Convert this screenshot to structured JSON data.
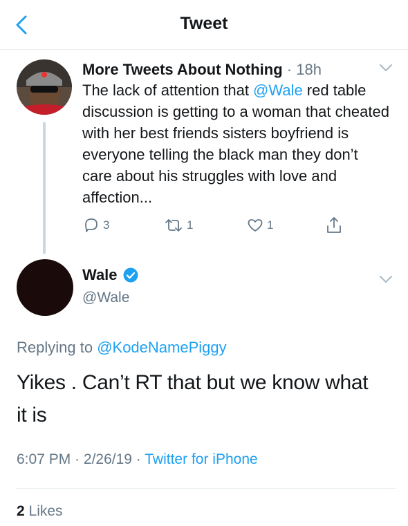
{
  "header": {
    "title": "Tweet"
  },
  "parent_tweet": {
    "author_name": "More Tweets About Nothing",
    "separator": " · ",
    "time": "18h",
    "text_before": "The lack of attention that ",
    "mention": "@Wale",
    "text_after": " red table discussion is getting to a woman that cheated with her best friends sisters boyfriend is everyone telling the black man they don’t care about his struggles with love and affection...",
    "reply_count": "3",
    "retweet_count": "1",
    "like_count": "1"
  },
  "main_tweet": {
    "author_name": "Wale",
    "handle": "@Wale",
    "replying_prefix": "Replying to ",
    "replying_to": "@KodeNamePiggy",
    "text": "Yikes . Can’t RT that but we know what it is",
    "time": "6:07 PM",
    "sep1": " · ",
    "date": "2/26/19",
    "sep2": " · ",
    "source": "Twitter for iPhone",
    "likes_count": "2",
    "likes_label": " Likes"
  },
  "colors": {
    "accent": "#1da1f2",
    "muted": "#657786",
    "text": "#14171a",
    "divider": "#e6ecf0"
  }
}
